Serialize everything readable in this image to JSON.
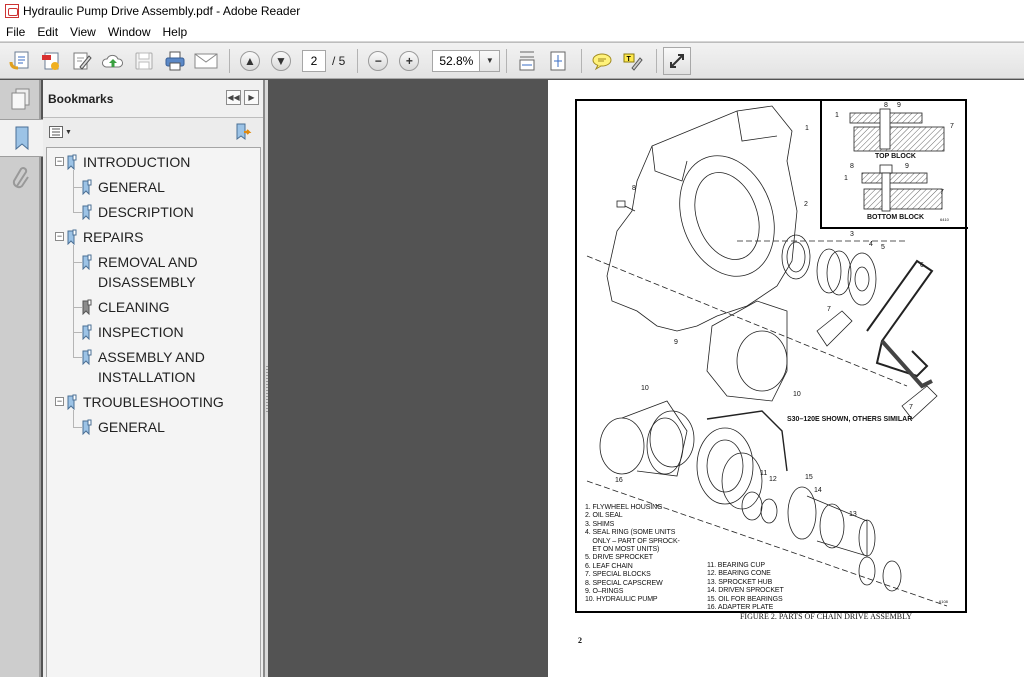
{
  "window": {
    "title": "Hydraulic Pump Drive Assembly.pdf - Adobe Reader"
  },
  "menu": [
    "File",
    "Edit",
    "View",
    "Window",
    "Help"
  ],
  "toolbar": {
    "page_current": "2",
    "page_total": "/ 5",
    "zoom_level": "52.8%",
    "buttons": [
      "create-pdf",
      "export",
      "sign",
      "upload-cloud",
      "save",
      "print",
      "email",
      "previous-page",
      "next-page",
      "zoom-out",
      "zoom-in",
      "scroll-mode",
      "fit-page",
      "comment",
      "highlight",
      "expand"
    ]
  },
  "bookmarks": {
    "title": "Bookmarks",
    "items": [
      {
        "label": "INTRODUCTION",
        "level": 0,
        "expanded": true
      },
      {
        "label": "GENERAL",
        "level": 1
      },
      {
        "label": "DESCRIPTION",
        "level": 1
      },
      {
        "label": "REPAIRS",
        "level": 0,
        "expanded": true
      },
      {
        "label": "REMOVAL AND",
        "label2": "DISASSEMBLY",
        "level": 1
      },
      {
        "label": "CLEANING",
        "level": 1
      },
      {
        "label": "INSPECTION",
        "level": 1
      },
      {
        "label": "ASSEMBLY AND",
        "label2": "INSTALLATION",
        "level": 1
      },
      {
        "label": "TROUBLESHOOTING",
        "level": 0,
        "expanded": true
      },
      {
        "label": "GENERAL",
        "level": 1
      }
    ]
  },
  "document": {
    "inset_labels": {
      "top": "TOP BLOCK",
      "bottom": "BOTTOM BLOCK",
      "code": "6410"
    },
    "note": "S30–120E SHOWN, OTHERS SIMILAR",
    "legend_left": [
      "1. FLYWHEEL HOUSING",
      "2. OIL SEAL",
      "3. SHIMS",
      "4. SEAL RING (SOME UNITS",
      "    ONLY – PART OF SPROCK-",
      "    ET ON MOST UNITS)",
      "5. DRIVE SPROCKET",
      "6. LEAF CHAIN",
      "7. SPECIAL BLOCKS",
      "8. SPECIAL CAPSCREW",
      "9. O–RINGS",
      "10. HYDRAULIC PUMP"
    ],
    "legend_right": [
      "11. BEARING CUP",
      "12. BEARING CONE",
      "13. SPROCKET HUB",
      "14. DRIVEN SPROCKET",
      "15. OIL FOR BEARINGS",
      "16. ADAPTER PLATE"
    ],
    "figure_code": "6108",
    "caption": "FIGURE 2. PARTS OF CHAIN DRIVE ASSEMBLY",
    "page_number": "2"
  }
}
